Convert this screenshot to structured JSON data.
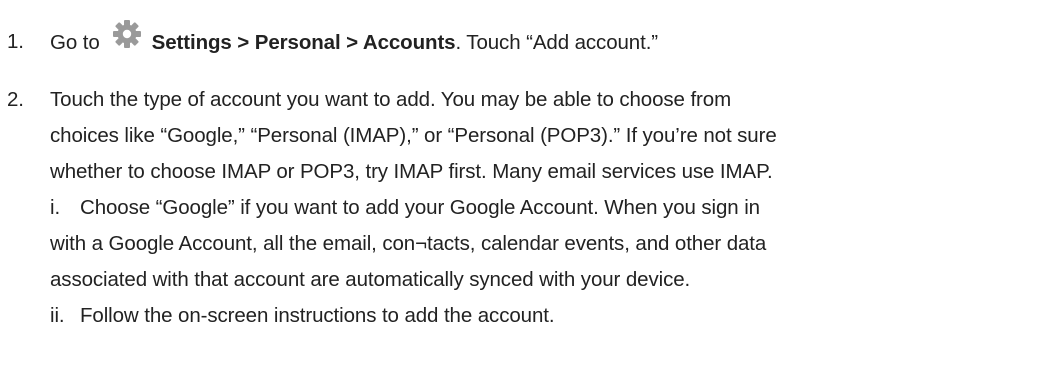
{
  "steps": [
    {
      "number": "1.",
      "icon": "gear-icon",
      "prefix": "Go to",
      "path": "Settings > Personal > Accounts",
      "suffix": ". Touch “Add account.”"
    },
    {
      "number": "2.",
      "lines": [
        "Touch the type of account you want to add. You may be able to choose from",
        "choices like “Google,” “Personal (IMAP),” or “Personal (POP3).” If you’re not sure",
        "whether to choose IMAP or POP3, try IMAP first. Many email services use IMAP."
      ],
      "substeps": [
        {
          "label": "i.",
          "lines": [
            "Choose “Google” if you want to add your Google Account. When you sign in",
            "with a Google Account, all the email, con¬tacts, calendar events, and other data",
            "associated with that account are automatically synced with your device."
          ]
        },
        {
          "label": "ii.",
          "lines": [
            "Follow the on-screen instructions to add the account."
          ]
        }
      ]
    }
  ]
}
